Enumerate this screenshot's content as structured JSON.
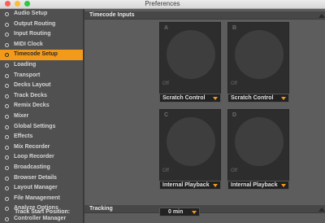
{
  "window": {
    "title": "Preferences"
  },
  "sidebar": {
    "items": [
      {
        "label": "Audio Setup",
        "active": false
      },
      {
        "label": "Output Routing",
        "active": false
      },
      {
        "label": "Input Routing",
        "active": false
      },
      {
        "label": "MIDI Clock",
        "active": false
      },
      {
        "label": "Timecode Setup",
        "active": true
      },
      {
        "label": "Loading",
        "active": false
      },
      {
        "label": "Transport",
        "active": false
      },
      {
        "label": "Decks Layout",
        "active": false
      },
      {
        "label": "Track Decks",
        "active": false
      },
      {
        "label": "Remix Decks",
        "active": false
      },
      {
        "label": "Mixer",
        "active": false
      },
      {
        "label": "Global Settings",
        "active": false
      },
      {
        "label": "Effects",
        "active": false
      },
      {
        "label": "Mix Recorder",
        "active": false
      },
      {
        "label": "Loop Recorder",
        "active": false
      },
      {
        "label": "Broadcasting",
        "active": false
      },
      {
        "label": "Browser Details",
        "active": false
      },
      {
        "label": "Layout Manager",
        "active": false
      },
      {
        "label": "File Management",
        "active": false
      },
      {
        "label": "Analyze Options",
        "active": false
      },
      {
        "label": "Controller Manager",
        "active": false
      }
    ]
  },
  "timecode_inputs": {
    "header": "Timecode Inputs",
    "decks": [
      {
        "letter": "A",
        "status": "Off",
        "mode": "Scratch Control"
      },
      {
        "letter": "B",
        "status": "Off",
        "mode": "Scratch Control"
      },
      {
        "letter": "C",
        "status": "Off",
        "mode": "Internal Playback"
      },
      {
        "letter": "D",
        "status": "Off",
        "mode": "Internal Playback"
      }
    ]
  },
  "tracking": {
    "header": "Tracking",
    "track_start_label": "Track Start Position:",
    "track_start_value": "0 min"
  },
  "colors": {
    "accent": "#f39a1a",
    "sidebar_bg": "#505050",
    "panel_bg": "#5d5d5d",
    "deck_bg": "#2d2d2d"
  }
}
